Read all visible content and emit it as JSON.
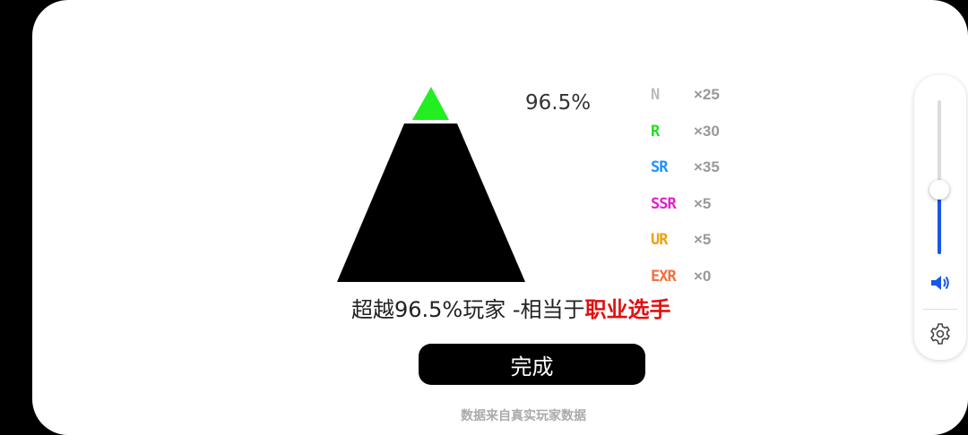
{
  "result": {
    "percent_label": "96.5%",
    "percent_value": 96.5,
    "summary_prefix": "超越96.5%玩家 -相当于",
    "summary_rank": "职业选手",
    "done_label": "完成",
    "footnote": "数据来自真实玩家数据"
  },
  "rarities": [
    {
      "label": "N",
      "count": "×25",
      "color": "#bbbbbb"
    },
    {
      "label": "R",
      "count": "×30",
      "color": "#22dd22"
    },
    {
      "label": "SR",
      "count": "×35",
      "color": "#1e90ff"
    },
    {
      "label": "SSR",
      "count": "×5",
      "color": "#e020d0"
    },
    {
      "label": "UR",
      "count": "×5",
      "color": "#f0a010"
    },
    {
      "label": "EXR",
      "count": "×0",
      "color": "#f07040"
    }
  ],
  "colors": {
    "pyramid_top": "#22ee22",
    "pyramid_body": "#000000",
    "rank_text": "#e01010",
    "volume_accent": "#1a56e8"
  },
  "volume": {
    "level": 0.42,
    "icon": "speaker-icon",
    "settings_icon": "gear-icon"
  }
}
